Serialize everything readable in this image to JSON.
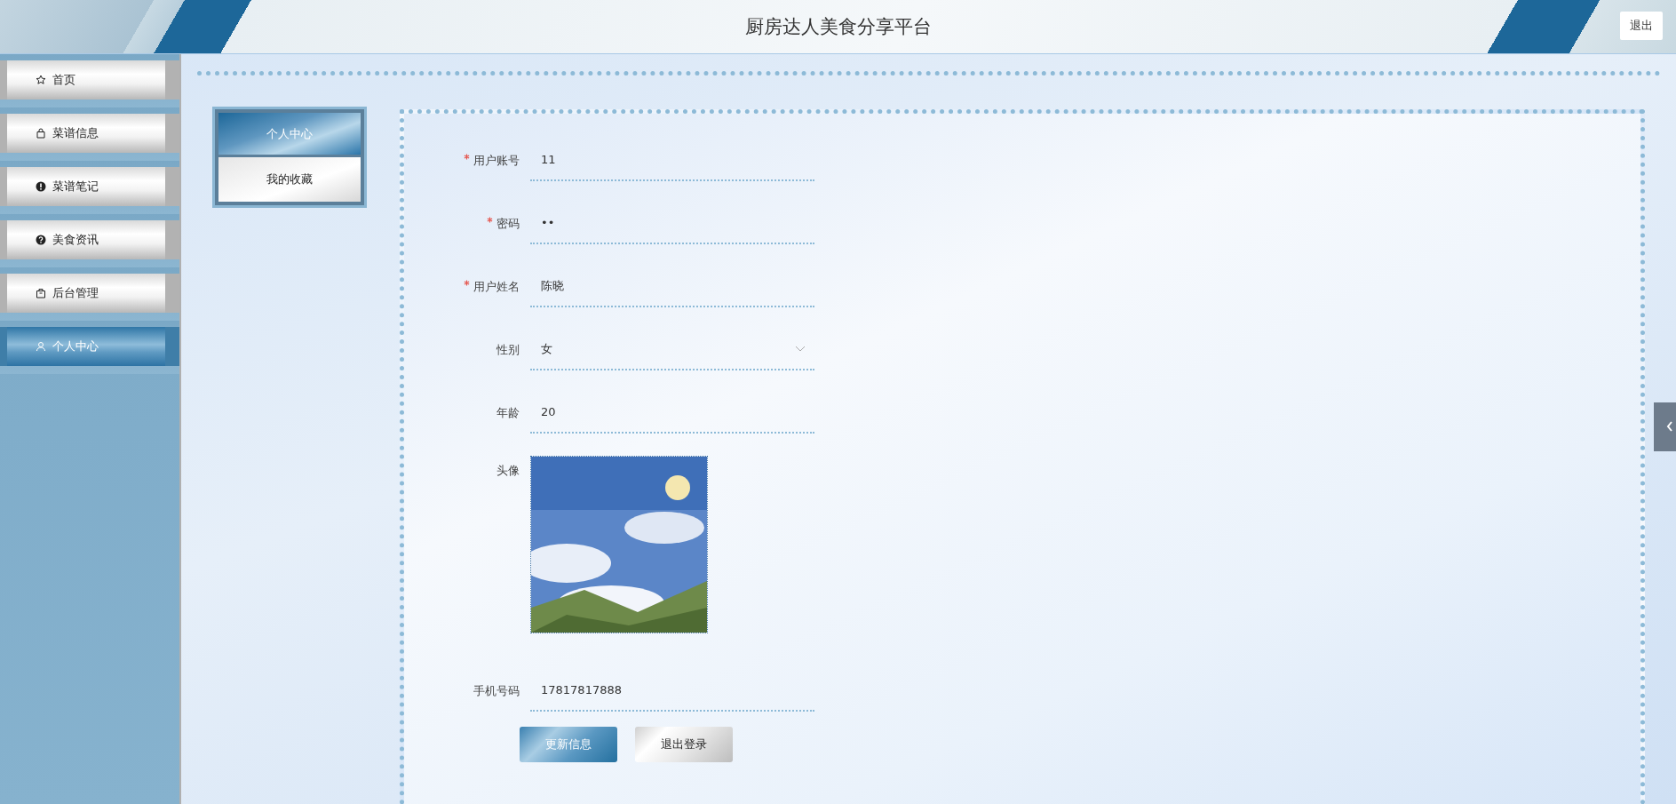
{
  "header": {
    "title": "厨房达人美食分享平台",
    "logout_button": "退出"
  },
  "sidebar": {
    "items": [
      {
        "label": "首页",
        "selected": false
      },
      {
        "label": "菜谱信息",
        "selected": false
      },
      {
        "label": "菜谱笔记",
        "selected": false
      },
      {
        "label": "美食资讯",
        "selected": false
      },
      {
        "label": "后台管理",
        "selected": false
      },
      {
        "label": "个人中心",
        "selected": true
      }
    ]
  },
  "submenu": {
    "items": [
      {
        "label": "个人中心",
        "selected": true
      },
      {
        "label": "我的收藏",
        "selected": false
      }
    ]
  },
  "form": {
    "fields": [
      {
        "kind": "text",
        "label": "用户账号",
        "required": true,
        "value": "11"
      },
      {
        "kind": "password",
        "label": "密码",
        "required": true,
        "value": "••"
      },
      {
        "kind": "text",
        "label": "用户姓名",
        "required": true,
        "value": "陈晓"
      },
      {
        "kind": "select",
        "label": "性别",
        "required": false,
        "value": "女"
      },
      {
        "kind": "text",
        "label": "年龄",
        "required": false,
        "value": "20"
      },
      {
        "label": "头像",
        "required": false
      },
      {
        "kind": "text",
        "label": "手机号码",
        "required": false,
        "value": "17817817888"
      }
    ],
    "buttons": [
      {
        "kind": "primary",
        "label": "更新信息"
      },
      {
        "kind": "default",
        "label": "退出登录"
      }
    ]
  }
}
